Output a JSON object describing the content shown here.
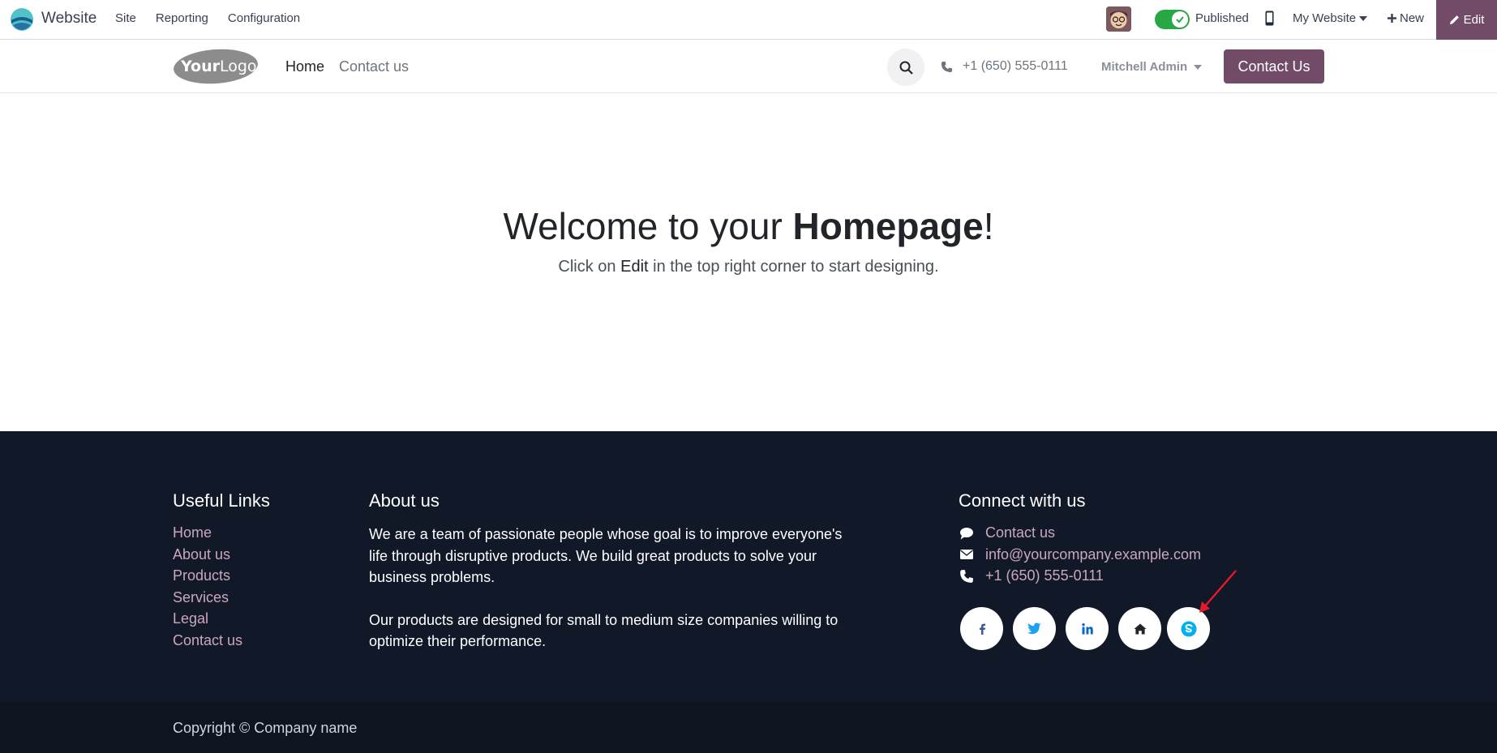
{
  "adminbar": {
    "app_name": "Website",
    "menu": [
      "Site",
      "Reporting",
      "Configuration"
    ],
    "published_label": "Published",
    "website_selector": "My Website",
    "new_label": "New",
    "edit_label": "Edit",
    "accent_color": "#714b67",
    "toggle_color": "#28a745"
  },
  "header": {
    "logo_text": "YourLogo",
    "nav": [
      "Home",
      "Contact us"
    ],
    "phone": "+1 (650) 555-0111",
    "user": "Mitchell Admin",
    "cta_label": "Contact Us"
  },
  "hero": {
    "title_prefix": "Welcome to your ",
    "title_bold": "Homepage",
    "title_suffix": "!",
    "sub_prefix": "Click on ",
    "sub_bold": "Edit",
    "sub_suffix": " in the top right corner to start designing."
  },
  "footer": {
    "useful_links_title": "Useful Links",
    "useful_links": [
      "Home",
      "About us",
      "Products",
      "Services",
      "Legal",
      "Contact us"
    ],
    "about_title": "About us",
    "about_p1": "We are a team of passionate people whose goal is to improve everyone's life through disruptive products. We build great products to solve your business problems.",
    "about_p2": "Our products are designed for small to medium size companies willing to optimize their performance.",
    "connect_title": "Connect with us",
    "connect_contact": "Contact us",
    "connect_email": "info@yourcompany.example.com",
    "connect_phone": "+1 (650) 555-0111",
    "socials": [
      "facebook-icon",
      "twitter-icon",
      "linkedin-icon",
      "home-icon",
      "skype-icon"
    ],
    "copyright": "Copyright © Company name",
    "bg_color": "#111827",
    "link_color": "#c9a6c1"
  }
}
